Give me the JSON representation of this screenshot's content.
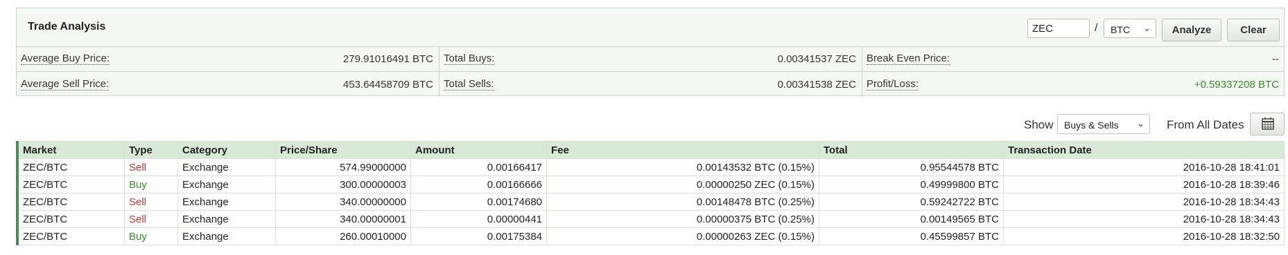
{
  "analysis": {
    "title": "Trade Analysis",
    "coin_value": "ZEC",
    "quote_value": "BTC",
    "analyze_label": "Analyze",
    "clear_label": "Clear",
    "stats": {
      "avg_buy_label": "Average Buy Price:",
      "avg_buy_value": "279.91016491 BTC",
      "total_buys_label": "Total Buys:",
      "total_buys_value": "0.00341537 ZEC",
      "break_even_label": "Break Even Price:",
      "break_even_value": "--",
      "avg_sell_label": "Average Sell Price:",
      "avg_sell_value": "453.64458709 BTC",
      "total_sells_label": "Total Sells:",
      "total_sells_value": "0.00341538 ZEC",
      "pl_label": "Profit/Loss:",
      "pl_value": "+0.59337208 BTC",
      "pl_color": "#3a8a2e"
    }
  },
  "filters": {
    "show_label": "Show",
    "show_value": "Buys & Sells",
    "dates_label": "From All Dates",
    "calendar_icon": "calendar-icon"
  },
  "table": {
    "headers": [
      "Market",
      "Type",
      "Category",
      "Price/Share",
      "Amount",
      "Fee",
      "Total",
      "Transaction Date"
    ],
    "rows": [
      {
        "market": "ZEC/BTC",
        "type": "Sell",
        "category": "Exchange",
        "price": "574.99000000",
        "amount": "0.00166417",
        "fee": "0.00143532 BTC (0.15%)",
        "total": "0.95544578 BTC",
        "date": "2016-10-28 18:41:01"
      },
      {
        "market": "ZEC/BTC",
        "type": "Buy",
        "category": "Exchange",
        "price": "300.00000003",
        "amount": "0.00166666",
        "fee": "0.00000250 ZEC (0.15%)",
        "total": "0.49999800 BTC",
        "date": "2016-10-28 18:39:46"
      },
      {
        "market": "ZEC/BTC",
        "type": "Sell",
        "category": "Exchange",
        "price": "340.00000000",
        "amount": "0.00174680",
        "fee": "0.00148478 BTC (0.25%)",
        "total": "0.59242722 BTC",
        "date": "2016-10-28 18:34:43"
      },
      {
        "market": "ZEC/BTC",
        "type": "Sell",
        "category": "Exchange",
        "price": "340.00000001",
        "amount": "0.00000441",
        "fee": "0.00000375 BTC (0.25%)",
        "total": "0.00149565 BTC",
        "date": "2016-10-28 18:34:43"
      },
      {
        "market": "ZEC/BTC",
        "type": "Buy",
        "category": "Exchange",
        "price": "260.00010000",
        "amount": "0.00175384",
        "fee": "0.00000263 ZEC (0.15%)",
        "total": "0.45599857 BTC",
        "date": "2016-10-28 18:32:50"
      }
    ],
    "colors": {
      "sell": "#c0392b",
      "buy": "#3a8a2e",
      "header_bg": "#d8e9d8",
      "row_strip": "#4a8a5a"
    }
  }
}
